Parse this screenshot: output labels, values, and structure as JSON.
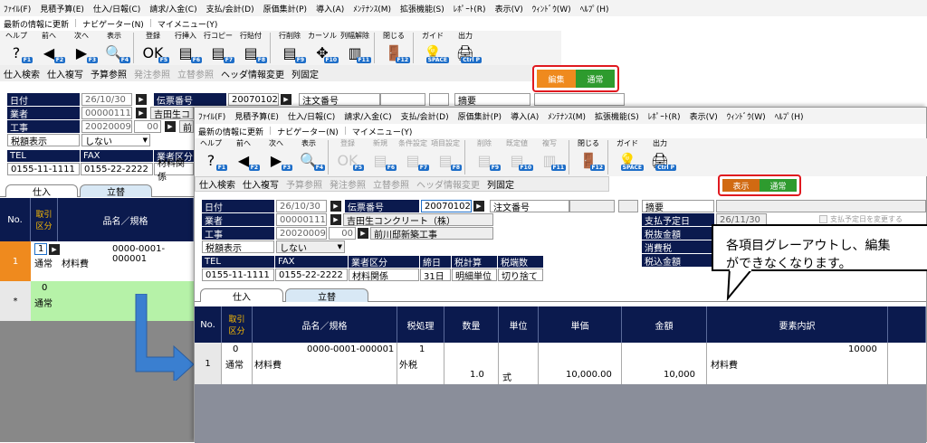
{
  "menu": [
    "ﾌｧｲﾙ(F)",
    "見積予算(E)",
    "仕入/日報(C)",
    "請求/入金(C)",
    "支払/会計(D)",
    "原価集計(P)",
    "導入(A)",
    "ﾒﾝﾃﾅﾝｽ(M)",
    "拡張機能(S)",
    "ﾚﾎﾟｰﾄ(R)",
    "表示(V)",
    "ｳｨﾝﾄﾞｳ(W)",
    "ﾍﾙﾌﾟ(H)"
  ],
  "subbar": [
    "最新の情報に更新",
    "ナビゲーター(N)",
    "マイメニュー(Y)"
  ],
  "back": {
    "toolbar": [
      {
        "label": "ヘルプ",
        "key": "F1",
        "icon": "?"
      },
      {
        "label": "前へ",
        "key": "F2",
        "icon": "◀"
      },
      {
        "label": "次へ",
        "key": "F3",
        "icon": "▶"
      },
      {
        "label": "表示",
        "key": "F4",
        "icon": "🔍"
      },
      {
        "label": "登録",
        "key": "F5",
        "icon": "OK"
      },
      {
        "label": "行挿入",
        "key": "F6",
        "icon": "▤"
      },
      {
        "label": "行コピー",
        "key": "F7",
        "icon": "▤"
      },
      {
        "label": "行貼付",
        "key": "F8",
        "icon": "▤"
      },
      {
        "label": "行削除",
        "key": "F9",
        "icon": "▤"
      },
      {
        "label": "カーソル",
        "key": "F10",
        "icon": "✥"
      },
      {
        "label": "列幅解除",
        "key": "F11",
        "icon": "▥"
      },
      {
        "label": "閉じる",
        "key": "F12",
        "icon": "🚪"
      },
      {
        "label": "ガイド",
        "key": "SPACE",
        "icon": "💡"
      },
      {
        "label": "出力",
        "key": "Ctrl P",
        "icon": "🖨"
      }
    ],
    "actions": [
      "仕入検索",
      "仕入複写",
      "予算参照",
      "発注参照",
      "立替参照",
      "ヘッダ情報変更",
      "列固定"
    ],
    "mode": {
      "left": "編集",
      "right": "通常"
    },
    "fields": {
      "date_label": "日付",
      "date": "26/10/30",
      "slip_label": "伝票番号",
      "slip": "20070102",
      "vendor_label": "業者",
      "vendor_code": "00000111",
      "vendor_name": "吉田生コ",
      "work_label": "工事",
      "work_code": "20020009",
      "work_sub": "00",
      "work_name": "前",
      "tax_label": "税額表示",
      "tax": "しない",
      "tel_h": "TEL",
      "fax_h": "FAX",
      "kind_h": "業者区分",
      "tel": "0155-11-1111",
      "fax": "0155-22-2222",
      "kind": "材料関係",
      "cust_label": "注文番号",
      "summary_label": "摘要"
    },
    "tabs": [
      "仕入",
      "立替"
    ],
    "grid_head": [
      "No.",
      "取引区分",
      "品名／規格"
    ],
    "rows": [
      {
        "no": "1",
        "kind_code": "1",
        "kind": "通常",
        "item": "材料費",
        "code": "0000-0001-000001"
      },
      {
        "no": "*",
        "kind_code": "0",
        "kind": "通常",
        "item": "",
        "code": ""
      }
    ]
  },
  "front": {
    "toolbar": [
      {
        "label": "ヘルプ",
        "key": "F1",
        "icon": "?"
      },
      {
        "label": "前へ",
        "key": "F2",
        "icon": "◀"
      },
      {
        "label": "次へ",
        "key": "F3",
        "icon": "▶"
      },
      {
        "label": "表示",
        "key": "F4",
        "icon": "🔍"
      },
      {
        "label": "登録",
        "key": "F5",
        "icon": "OK"
      },
      {
        "label": "新規",
        "key": "F6",
        "icon": "▤"
      },
      {
        "label": "条件設定",
        "key": "F7",
        "icon": "▤"
      },
      {
        "label": "項目設定",
        "key": "F8",
        "icon": "▤"
      },
      {
        "label": "削除",
        "key": "F9",
        "icon": "▤"
      },
      {
        "label": "既定値",
        "key": "F10",
        "icon": "▤"
      },
      {
        "label": "複写",
        "key": "F11",
        "icon": "▥"
      },
      {
        "label": "閉じる",
        "key": "F12",
        "icon": "🚪"
      },
      {
        "label": "ガイド",
        "key": "SPACE",
        "icon": "💡"
      },
      {
        "label": "出力",
        "key": "Ctrl P",
        "icon": "🖨"
      }
    ],
    "actions": [
      "仕入検索",
      "仕入複写",
      "予算参照",
      "発注参照",
      "立替参照",
      "ヘッダ情報変更",
      "列固定"
    ],
    "mode": {
      "left": "表示",
      "right": "通常"
    },
    "fields": {
      "date_label": "日付",
      "date": "26/10/30",
      "slip_label": "伝票番号",
      "slip": "20070102",
      "vendor_label": "業者",
      "vendor_code": "00000111",
      "vendor_name": "吉田生コンクリート（株）",
      "work_label": "工事",
      "work_code": "20020009",
      "work_sub": "00",
      "work_name": "前川邸新築工事",
      "tax_label": "税額表示",
      "tax": "しない",
      "tel_h": "TEL",
      "fax_h": "FAX",
      "kind_h": "業者区分",
      "close_h": "締日",
      "calc_h": "税計算",
      "frac_h": "税端数",
      "tel": "0155-11-1111",
      "fax": "0155-22-2222",
      "kind": "材料関係",
      "close": "31日",
      "calc": "明細単位",
      "frac": "切り捨て",
      "cust_label": "注文番号",
      "summary_label": "摘要",
      "pay_label": "支払予定日",
      "pay": "26/11/30",
      "pay_check": "支払予定日を変更する",
      "net_label": "税抜金額",
      "tax_amt_label": "消費税",
      "gross_label": "税込金額"
    },
    "tabs": [
      "仕入",
      "立替"
    ],
    "grid_head": [
      "No.",
      "取引区分",
      "品名／規格",
      "税処理",
      "数量",
      "単位",
      "単価",
      "金額",
      "要素内訳"
    ],
    "row": {
      "no": "1",
      "kind_code": "0",
      "kind": "通常",
      "code": "0000-0001-000001",
      "item": "材料費",
      "tax_code": "1",
      "tax": "外税",
      "qty": "1.0",
      "unit": "式",
      "price": "10,000.00",
      "amount": "10,000",
      "elem": "材料費",
      "elem_amt": "10000"
    }
  },
  "callout": {
    "line1": "各項目グレーアウトし、編集",
    "line2": "ができなくなります。"
  },
  "colors": {
    "navy": "#0b1a4e",
    "orange": "#ef8a1e",
    "green": "#2e9b2e",
    "red": "#e0191f",
    "arrow": "#3a7fd0"
  }
}
